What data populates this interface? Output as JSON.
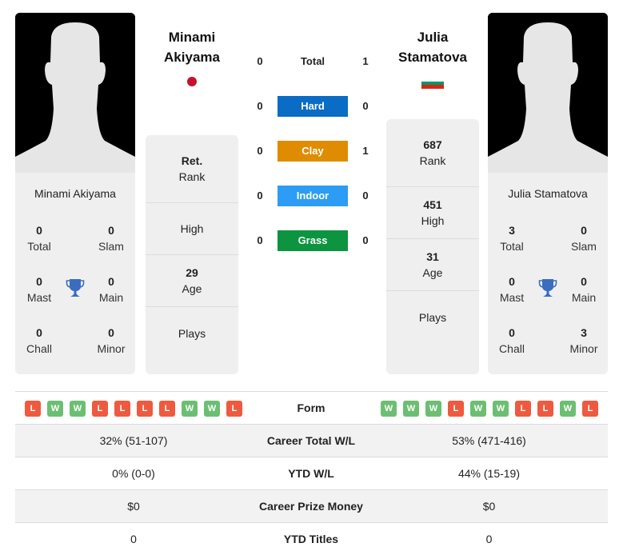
{
  "player_left": {
    "name_first": "Minami",
    "name_last": "Akiyama",
    "full_name": "Minami Akiyama",
    "country_flag": "japan",
    "titles": {
      "total": "0",
      "slam": "0",
      "mast": "0",
      "main": "0",
      "chall": "0",
      "minor": "0"
    },
    "rank": {
      "value": "Ret.",
      "label": "Rank"
    },
    "high": {
      "value": "",
      "label": "High"
    },
    "age": {
      "value": "29",
      "label": "Age"
    },
    "plays": {
      "value": "",
      "label": "Plays"
    },
    "form": [
      "L",
      "W",
      "W",
      "L",
      "L",
      "L",
      "L",
      "W",
      "W",
      "L"
    ]
  },
  "player_right": {
    "name_first": "Julia",
    "name_last": "Stamatova",
    "full_name": "Julia Stamatova",
    "country_flag": "bulgaria",
    "titles": {
      "total": "3",
      "slam": "0",
      "mast": "0",
      "main": "0",
      "chall": "0",
      "minor": "3"
    },
    "rank": {
      "value": "687",
      "label": "Rank"
    },
    "high": {
      "value": "451",
      "label": "High"
    },
    "age": {
      "value": "31",
      "label": "Age"
    },
    "plays": {
      "value": "",
      "label": "Plays"
    },
    "form": [
      "W",
      "W",
      "W",
      "L",
      "W",
      "W",
      "L",
      "L",
      "W",
      "L"
    ]
  },
  "title_labels": {
    "total": "Total",
    "slam": "Slam",
    "mast": "Mast",
    "main": "Main",
    "chall": "Chall",
    "minor": "Minor"
  },
  "h2h": [
    {
      "label": "Total",
      "left": "0",
      "right": "1",
      "color": ""
    },
    {
      "label": "Hard",
      "left": "0",
      "right": "0",
      "color": "#0a6cc4"
    },
    {
      "label": "Clay",
      "left": "0",
      "right": "1",
      "color": "#df8c00"
    },
    {
      "label": "Indoor",
      "left": "0",
      "right": "0",
      "color": "#2d9cf5"
    },
    {
      "label": "Grass",
      "left": "0",
      "right": "0",
      "color": "#0d9440"
    }
  ],
  "stats": [
    {
      "label": "Form",
      "left": "",
      "right": ""
    },
    {
      "label": "Career Total W/L",
      "left": "32% (51-107)",
      "right": "53% (471-416)"
    },
    {
      "label": "YTD W/L",
      "left": "0% (0-0)",
      "right": "44% (15-19)"
    },
    {
      "label": "Career Prize Money",
      "left": "$0",
      "right": "$0"
    },
    {
      "label": "YTD Titles",
      "left": "0",
      "right": "0"
    }
  ],
  "colors": {
    "win": "#6cbf72",
    "loss": "#ee5a3f",
    "trophy": "#3a6dbf",
    "card_bg": "#efefef"
  }
}
